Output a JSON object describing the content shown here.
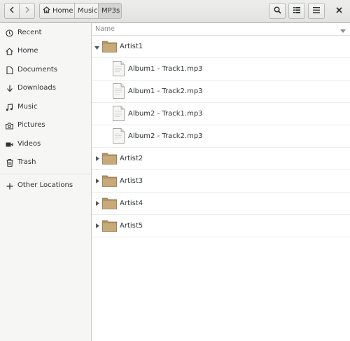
{
  "toolbar": {
    "breadcrumbs": [
      "Home",
      "Music",
      "MP3s"
    ]
  },
  "sidebar": {
    "items": [
      {
        "label": "Recent",
        "icon": "clock-icon"
      },
      {
        "label": "Home",
        "icon": "home-icon"
      },
      {
        "label": "Documents",
        "icon": "document-icon"
      },
      {
        "label": "Downloads",
        "icon": "download-icon"
      },
      {
        "label": "Music",
        "icon": "music-icon"
      },
      {
        "label": "Pictures",
        "icon": "camera-icon"
      },
      {
        "label": "Videos",
        "icon": "video-icon"
      },
      {
        "label": "Trash",
        "icon": "trash-icon"
      },
      {
        "label": "Other Locations",
        "icon": "plus-icon"
      }
    ]
  },
  "main": {
    "column_header": "Name",
    "rows": [
      {
        "type": "folder",
        "name": "Artist1",
        "expanded": true
      },
      {
        "type": "file",
        "name": "Album1 - Track1.mp3"
      },
      {
        "type": "file",
        "name": "Album1 - Track2.mp3"
      },
      {
        "type": "file",
        "name": "Album2 - Track1.mp3"
      },
      {
        "type": "file",
        "name": "Album2 - Track2.mp3"
      },
      {
        "type": "folder",
        "name": "Artist2",
        "expanded": false
      },
      {
        "type": "folder",
        "name": "Artist3",
        "expanded": false
      },
      {
        "type": "folder",
        "name": "Artist4",
        "expanded": false
      },
      {
        "type": "folder",
        "name": "Artist5",
        "expanded": false
      }
    ]
  },
  "colors": {
    "folder": "#c8a979",
    "folder_tab": "#b59565",
    "sidebar_bg": "#f6f6f5"
  }
}
